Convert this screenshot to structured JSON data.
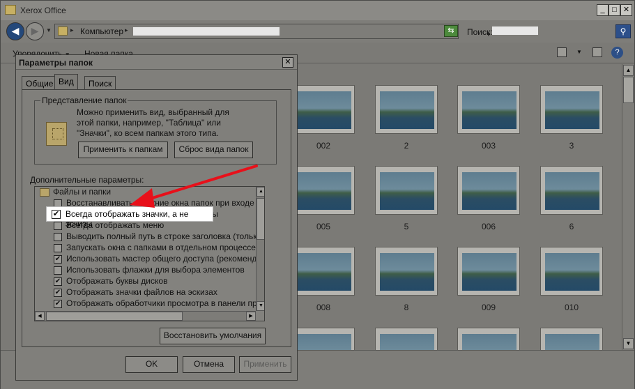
{
  "window": {
    "title": "Xerox Office",
    "controls": {
      "minimize": "_",
      "maximize": "□",
      "close": "✕"
    }
  },
  "addressbar": {
    "back_icon": "◀",
    "forward_icon": "▶",
    "root": "Компьютер",
    "search_label": "Поиск:"
  },
  "toolbar": {
    "organize": "Упорядочить",
    "new_folder": "Новая папка",
    "help": "?"
  },
  "thumbnails": [
    {
      "label": "002"
    },
    {
      "label": "2"
    },
    {
      "label": "003"
    },
    {
      "label": "3"
    },
    {
      "label": "005"
    },
    {
      "label": "5"
    },
    {
      "label": "006"
    },
    {
      "label": "6"
    },
    {
      "label": "008"
    },
    {
      "label": "8"
    },
    {
      "label": "009"
    },
    {
      "label": "010"
    },
    {
      "label": ""
    },
    {
      "label": ""
    },
    {
      "label": ""
    },
    {
      "label": ""
    }
  ],
  "dialog": {
    "title": "Параметры папок",
    "close": "✕",
    "tabs": [
      "Общие",
      "Вид",
      "Поиск"
    ],
    "active_tab": "Вид",
    "folder_views": {
      "label": "Представление папок",
      "description": "Можно применить вид, выбранный для этой папки, например, \"Таблица\" или \"Значки\", ко всем папкам этого типа.",
      "apply_button": "Применить к папкам",
      "reset_button": "Сброс вида папок"
    },
    "advanced_label": "Дополнительные параметры:",
    "tree_root": "Файлы и папки",
    "options": [
      {
        "label": "Восстанавливать прежние окна папок при входе в с",
        "checked": false
      },
      {
        "label": "Всегда отображать значки, а не эскизы",
        "checked": true
      },
      {
        "label": "Всегда отображать меню",
        "checked": false
      },
      {
        "label": "Выводить полный путь в строке заголовка (только д",
        "checked": false
      },
      {
        "label": "Запускать окна с папками в отдельном процессе",
        "checked": false
      },
      {
        "label": "Использовать мастер общего доступа (рекомендует",
        "checked": true
      },
      {
        "label": "Использовать флажки для выбора элементов",
        "checked": false
      },
      {
        "label": "Отображать буквы дисков",
        "checked": true
      },
      {
        "label": "Отображать значки файлов на эскизах",
        "checked": true
      },
      {
        "label": "Отображать обработчики просмотра в панели просм",
        "checked": true
      }
    ],
    "highlighted_option": "Всегда отображать значки, а не эскизы",
    "restore_defaults": "Восстановить умолчания",
    "ok": "OK",
    "cancel": "Отмена",
    "apply": "Применить"
  },
  "annotation": {
    "arrow_color": "#e8101a"
  }
}
